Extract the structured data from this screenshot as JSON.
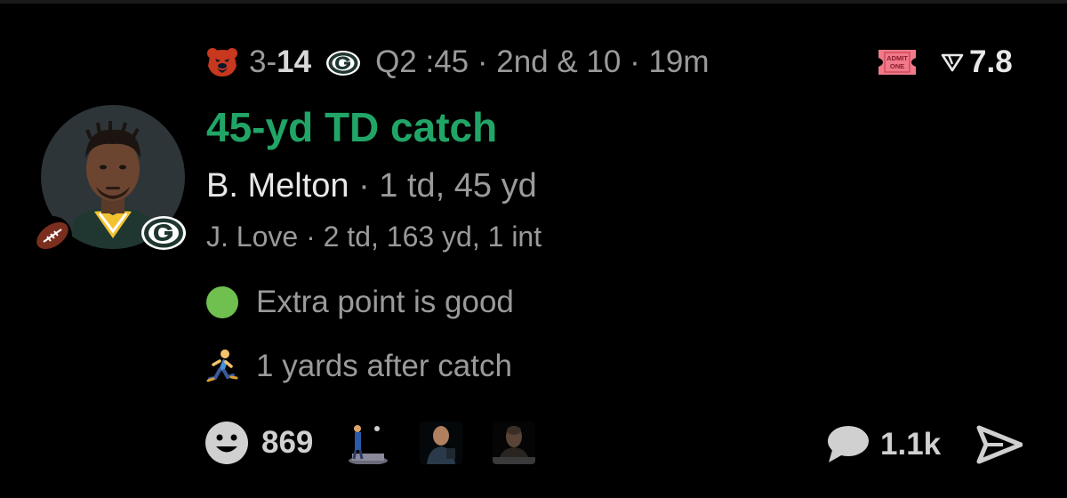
{
  "header": {
    "away_team_icon": "bears-logo-icon",
    "away_score": "3",
    "score_dash": "-",
    "home_score": "14",
    "home_team_icon": "packers-logo-icon",
    "game_status": "Q2 :45 · 2nd & 10 · 19m",
    "ticket_icon": "admit-one-ticket-icon",
    "ticket_text_line1": "ADMIT",
    "ticket_text_line2": "ONE",
    "odds_icon": "triangle-odds-icon",
    "odds_value": "7.8"
  },
  "play": {
    "headline": "45-yd TD catch",
    "player_name": "B. Melton",
    "player_stats": " · 1 td, 45 yd",
    "passer_line": "J. Love · 2 td, 163 yd, 1 int"
  },
  "events": [
    {
      "icon": "green-circle-icon",
      "text": "Extra point is good"
    },
    {
      "icon": "runner-icon",
      "text": "1 yards after catch"
    }
  ],
  "footer": {
    "reaction_icon": "smiley-icon",
    "reaction_count": "869",
    "comment_icon": "comment-bubble-icon",
    "comment_count": "1.1k",
    "share_icon": "share-arrow-icon"
  },
  "colors": {
    "background": "#000000",
    "headline_green": "#21a567",
    "muted_text": "#9a9a9a",
    "dot_green": "#6fc04f"
  }
}
